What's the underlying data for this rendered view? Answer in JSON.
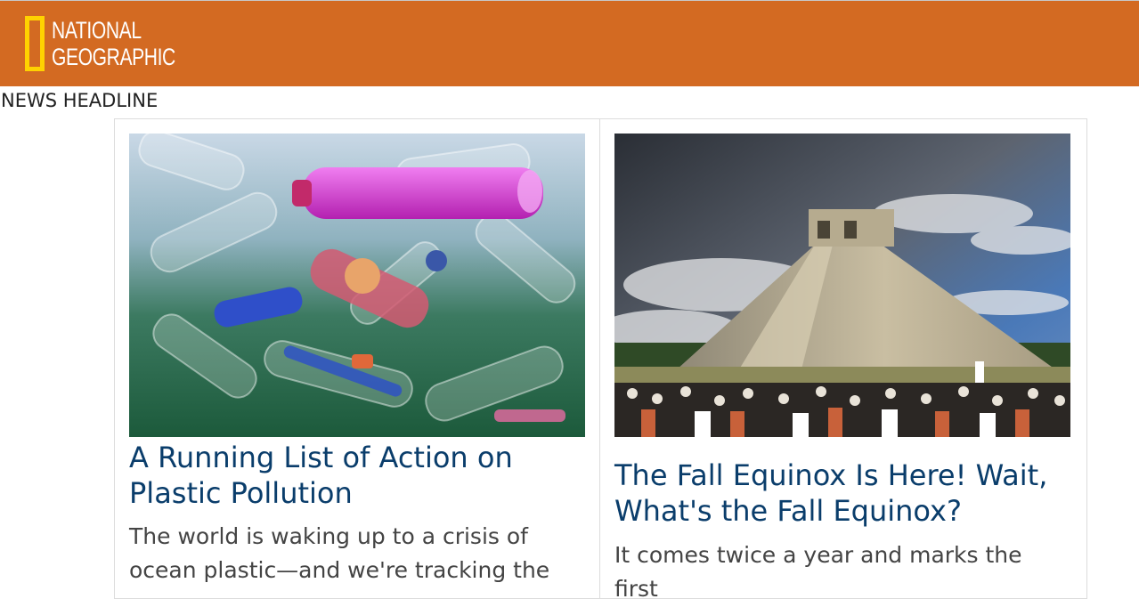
{
  "header": {
    "background_color": "#d36a22",
    "logo": {
      "line1": "NATIONAL",
      "line2": "GEOGRAPHIC",
      "frame_color": "#ffd200",
      "icon": "yellow-rectangle-icon"
    }
  },
  "section": {
    "heading": "NEWS HEADLINE"
  },
  "cards": [
    {
      "title": "A Running List of Action on Plastic Pollution",
      "description": "The world is waking up to a crisis of ocean plastic—and we're tracking the",
      "image": "plastic-bottles-underwater-photo"
    },
    {
      "title": "The Fall Equinox Is Here! Wait, What's the Fall Equinox?",
      "description": "It comes twice a year and marks the first",
      "image": "chichen-itza-pyramid-crowd-photo"
    }
  ],
  "colors": {
    "title": "#0a3d6b",
    "description": "#444444"
  }
}
